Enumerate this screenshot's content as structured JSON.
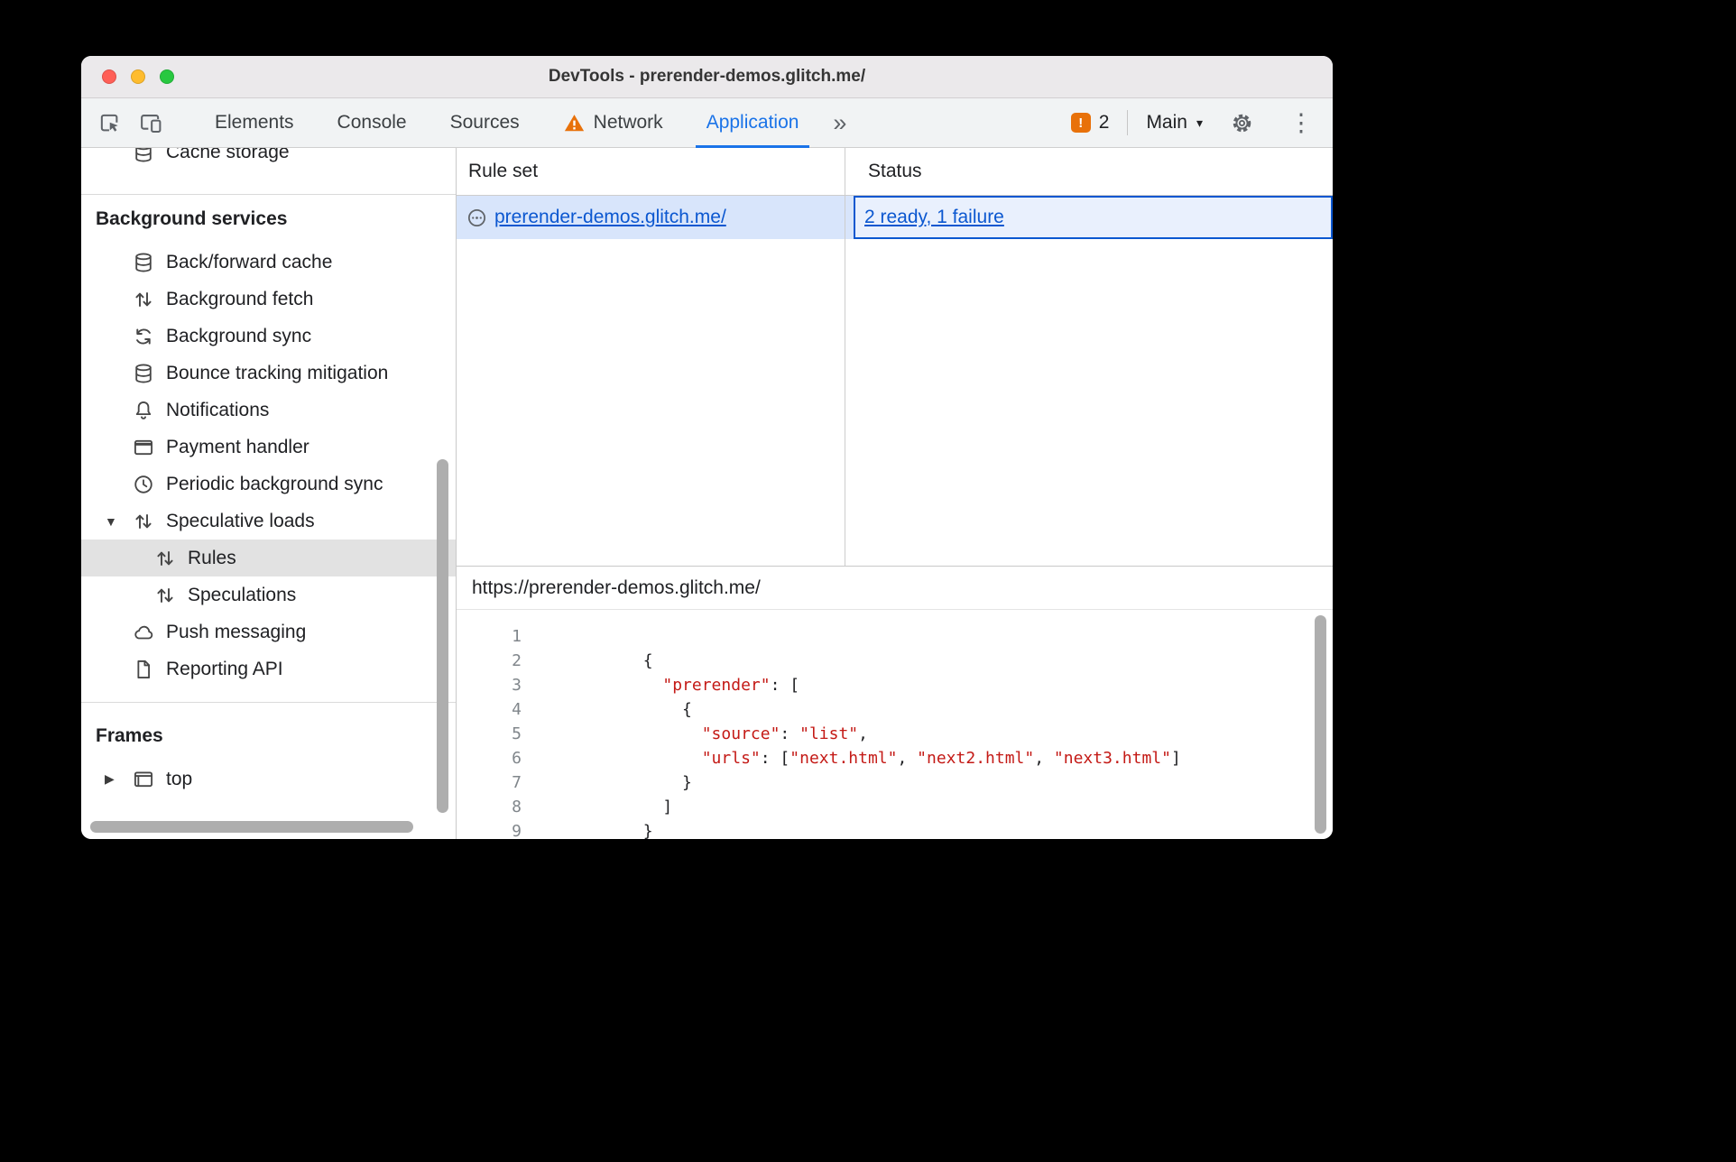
{
  "window": {
    "title": "DevTools - prerender-demos.glitch.me/"
  },
  "colors": {
    "accent_blue": "#1a73e8",
    "link_blue": "#0b57d0",
    "selected_row_blue": "#d8e5fb",
    "status_cell_blue": "#e9f0fd",
    "issues_orange": "#e8710a",
    "code_string_red": "#c41a16",
    "selected_sidebar_gray": "#e2e2e2"
  },
  "icons": {
    "issues-badge": "!",
    "overflow-tabs": "»",
    "dropdown-caret": "▾",
    "overflow-menu": "⋮",
    "expanded-triangle": "▼",
    "collapsed-triangle": "▶"
  },
  "toolbar": {
    "tabs": [
      "Elements",
      "Console",
      "Sources",
      "Network",
      "Application"
    ],
    "active_tab": "Application",
    "issues": {
      "count": "2"
    },
    "target": {
      "label": "Main"
    }
  },
  "sidebar": {
    "clipped_item": {
      "label": "Cache storage",
      "icon": "database-icon"
    },
    "sections": [
      {
        "heading": "Background services",
        "items": [
          {
            "label": "Back/forward cache",
            "icon": "database-icon"
          },
          {
            "label": "Background fetch",
            "icon": "up-down-arrows-icon"
          },
          {
            "label": "Background sync",
            "icon": "sync-icon"
          },
          {
            "label": "Bounce tracking mitigation",
            "icon": "database-icon"
          },
          {
            "label": "Notifications",
            "icon": "bell-icon"
          },
          {
            "label": "Payment handler",
            "icon": "card-icon"
          },
          {
            "label": "Periodic background sync",
            "icon": "clock-icon"
          },
          {
            "label": "Speculative loads",
            "icon": "up-down-arrows-icon",
            "expanded": true
          },
          {
            "label": "Rules",
            "icon": "up-down-arrows-icon",
            "child": true,
            "selected": true
          },
          {
            "label": "Speculations",
            "icon": "up-down-arrows-icon",
            "child": true
          },
          {
            "label": "Push messaging",
            "icon": "cloud-icon"
          },
          {
            "label": "Reporting API",
            "icon": "document-icon"
          }
        ]
      },
      {
        "heading": "Frames",
        "items": [
          {
            "label": "top",
            "icon": "frame-icon",
            "collapsed": true
          }
        ]
      }
    ]
  },
  "rule_sets": {
    "columns": [
      "Rule set",
      "Status"
    ],
    "rows": [
      {
        "rule_set": "prerender-demos.glitch.me/",
        "status": "2 ready, 1 failure"
      }
    ]
  },
  "detail": {
    "url": "https://prerender-demos.glitch.me/",
    "code_lines": [
      {
        "n": "1",
        "tokens": []
      },
      {
        "n": "2",
        "tokens": [
          {
            "c": "p",
            "t": "        {"
          }
        ]
      },
      {
        "n": "3",
        "tokens": [
          {
            "c": "p",
            "t": "          "
          },
          {
            "c": "s",
            "t": "\"prerender\""
          },
          {
            "c": "p",
            "t": ": ["
          }
        ]
      },
      {
        "n": "4",
        "tokens": [
          {
            "c": "p",
            "t": "            {"
          }
        ]
      },
      {
        "n": "5",
        "tokens": [
          {
            "c": "p",
            "t": "              "
          },
          {
            "c": "s",
            "t": "\"source\""
          },
          {
            "c": "p",
            "t": ": "
          },
          {
            "c": "s",
            "t": "\"list\""
          },
          {
            "c": "p",
            "t": ","
          }
        ]
      },
      {
        "n": "6",
        "tokens": [
          {
            "c": "p",
            "t": "              "
          },
          {
            "c": "s",
            "t": "\"urls\""
          },
          {
            "c": "p",
            "t": ": ["
          },
          {
            "c": "s",
            "t": "\"next.html\""
          },
          {
            "c": "p",
            "t": ", "
          },
          {
            "c": "s",
            "t": "\"next2.html\""
          },
          {
            "c": "p",
            "t": ", "
          },
          {
            "c": "s",
            "t": "\"next3.html\""
          },
          {
            "c": "p",
            "t": "]"
          }
        ]
      },
      {
        "n": "7",
        "tokens": [
          {
            "c": "p",
            "t": "            }"
          }
        ]
      },
      {
        "n": "8",
        "tokens": [
          {
            "c": "p",
            "t": "          ]"
          }
        ]
      },
      {
        "n": "9",
        "tokens": [
          {
            "c": "p",
            "t": "        }"
          }
        ]
      }
    ]
  }
}
